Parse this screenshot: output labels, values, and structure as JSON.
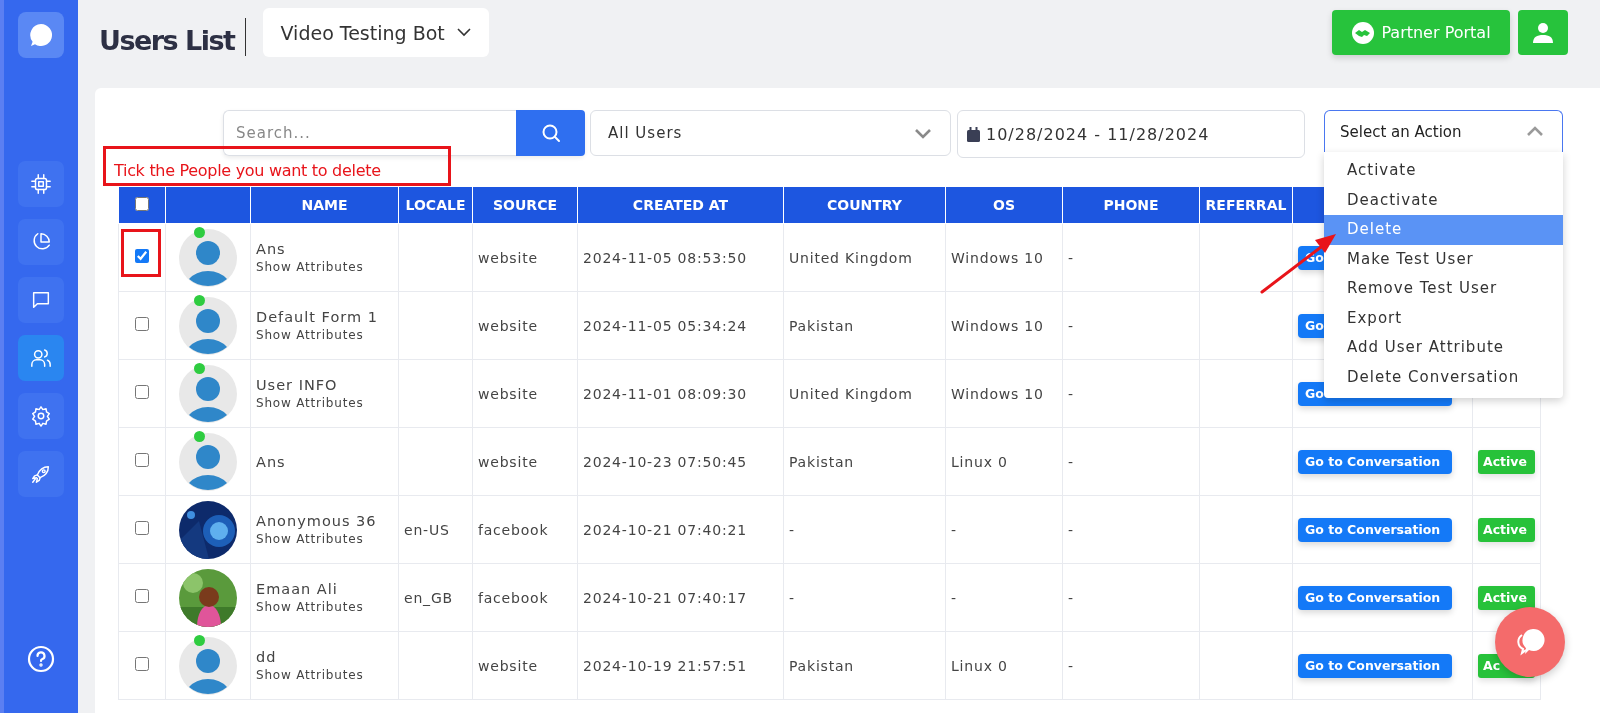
{
  "sidebar": {
    "items": [
      {
        "selected": false
      },
      {
        "selected": false
      },
      {
        "selected": false
      },
      {
        "selected": true
      },
      {
        "selected": false
      },
      {
        "selected": false
      }
    ]
  },
  "header": {
    "title": "Users List",
    "bot_selector": "Video Testing Bot",
    "partner_button": "Partner Portal"
  },
  "filters": {
    "search": {
      "placeholder": "Search..."
    },
    "user_filter": "All Users",
    "date_range": "10/28/2024 - 11/28/2024",
    "action_select": {
      "value": "Select an Action",
      "expanded": true,
      "options": [
        {
          "label": "Activate",
          "selected": false
        },
        {
          "label": "Deactivate",
          "selected": false
        },
        {
          "label": "Delete",
          "selected": true
        },
        {
          "label": "Make Test User",
          "selected": false
        },
        {
          "label": "Remove Test User",
          "selected": false
        },
        {
          "label": "Export",
          "selected": false
        },
        {
          "label": "Add User Attribute",
          "selected": false
        },
        {
          "label": "Delete Conversation",
          "selected": false
        }
      ]
    }
  },
  "annotation": "Tick the People you want to delete",
  "table": {
    "all_checked": false,
    "columns": [
      "NAME",
      "LOCALE",
      "SOURCE",
      "CREATED AT",
      "COUNTRY",
      "OS",
      "PHONE",
      "REFERRAL"
    ],
    "rows": [
      {
        "checked": true,
        "avatar": {
          "kind": "default",
          "online": true
        },
        "name": "Ans",
        "attributes_link": "Show Attributes",
        "source": "website",
        "created_at": "2024-11-05 08:53:50",
        "country": "United Kingdom",
        "os": "Windows 10",
        "phone": "-",
        "button": "Go"
      },
      {
        "checked": false,
        "avatar": {
          "kind": "default",
          "online": true
        },
        "name": "Default Form 1",
        "attributes_link": "Show Attributes",
        "source": "website",
        "created_at": "2024-11-05 05:34:24",
        "country": "Pakistan",
        "os": "Windows 10",
        "phone": "-",
        "button": "Go"
      },
      {
        "checked": false,
        "avatar": {
          "kind": "default",
          "online": true
        },
        "name": "User INFO",
        "attributes_link": "Show Attributes",
        "source": "website",
        "created_at": "2024-11-01 08:09:30",
        "country": "United Kingdom",
        "os": "Windows 10",
        "phone": "-",
        "button": "Go"
      },
      {
        "checked": false,
        "avatar": {
          "kind": "default",
          "online": true
        },
        "name": "Ans",
        "source": "website",
        "created_at": "2024-10-23 07:50:45",
        "country": "Pakistan",
        "os": "Linux 0",
        "phone": "-",
        "button": "Go to Conversation",
        "status": "Active"
      },
      {
        "checked": false,
        "name": "Anonymous 36",
        "attributes_link": "Show Attributes",
        "locale": "en-US",
        "source": "facebook",
        "created_at": "2024-10-21 07:40:21",
        "country": "-",
        "os": "-",
        "phone": "-",
        "button": "Go to Conversation",
        "status": "Active"
      },
      {
        "checked": false,
        "name": "Emaan Ali",
        "attributes_link": "Show Attributes",
        "locale": "en_GB",
        "source": "facebook",
        "created_at": "2024-10-21 07:40:17",
        "country": "-",
        "os": "-",
        "phone": "-",
        "button": "Go to Conversation",
        "status": "Active"
      },
      {
        "checked": false,
        "avatar": {
          "kind": "default",
          "online": true
        },
        "name": "dd",
        "attributes_link": "Show Attributes",
        "source": "website",
        "created_at": "2024-10-19 21:57:51",
        "country": "Pakistan",
        "os": "Linux 0",
        "phone": "-",
        "button": "Go to Conversation",
        "status": "Ac"
      }
    ]
  }
}
